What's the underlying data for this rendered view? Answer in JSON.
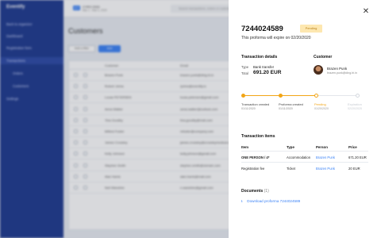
{
  "app": {
    "logo": "Eventify",
    "nav": [
      {
        "label": "Back to organizer",
        "sub": false
      },
      {
        "label": "Dashboard",
        "sub": false
      },
      {
        "label": "Registration form",
        "sub": false
      },
      {
        "label": "Transactions",
        "sub": false
      },
      {
        "label": "Orders",
        "sub": true
      },
      {
        "label": "Customers",
        "sub": true
      },
      {
        "label": "Settings",
        "sub": false
      }
    ],
    "event": {
      "badge": "EVT",
      "name": "CYRO 2020",
      "date": "Mar 1 - Mar 3, 2020"
    },
    "search_placeholder": "Search transactions, orders or customers",
    "page_title": "Customers",
    "filter_label": "Add a filter",
    "add_label": "Add",
    "table": {
      "columns": [
        "Customer",
        "Email"
      ],
      "rows": [
        [
          "Brazen Punk",
          "brazen.punk@ding.bi.in"
        ],
        [
          "Robert Johns",
          "rjohns@eventify.io"
        ],
        [
          "Lucas PETERSEN",
          "lucas.petersen@gmail.com"
        ],
        [
          "Anna Walker",
          "anna.walker@outlook.com"
        ],
        [
          "Tina Goodby",
          "tina.goodby@mail.com"
        ],
        [
          "Miltred Foster",
          "mfoster@company.com"
        ],
        [
          "James Crossley",
          "james.crossley@crossleymedical.co.uk"
        ],
        [
          "Kelly Johnson",
          "kelly.johnson@gmail.com"
        ],
        [
          "Stephen Smith",
          "stephen.smith@domain.com"
        ],
        [
          "Alan Harris",
          "alan.harris@mail.com"
        ],
        [
          "Neil Wanshire",
          "n.wanshire@gmail.com"
        ]
      ]
    }
  },
  "panel": {
    "close_icon": "close-icon",
    "proforma_number": "7244024589",
    "status": "Pending",
    "expire_text": "This proforma will expire on 02/20/2020",
    "details": {
      "heading": "Transaction details",
      "type_label": "Type",
      "type_value": "Bank transfer",
      "total_label": "Total",
      "total_value": "691.20 EUR"
    },
    "customer": {
      "heading": "Customer",
      "name": "Brazen Punk",
      "email": "brazen.punk@ding.bi.in"
    },
    "timeline": [
      {
        "label": "Transaction created",
        "date": "01/11/2020",
        "state": "done"
      },
      {
        "label": "Proforma created",
        "date": "01/11/2020",
        "state": "done"
      },
      {
        "label": "Pending",
        "date": "01/20/2020",
        "state": "current"
      },
      {
        "label": "Expiration",
        "date": "02/20/2020",
        "state": "future"
      }
    ],
    "items": {
      "heading": "Transaction items",
      "columns": [
        "Item",
        "Type",
        "Person",
        "Price"
      ],
      "rows": [
        {
          "item": "ONE PERSON / 4*",
          "type": "Accommodation",
          "person": "Brazen Punk",
          "price": "671.20 EUR"
        },
        {
          "item": "Registration fee",
          "type": "Ticket",
          "person": "Brazen Punk",
          "price": "20 EUR"
        }
      ]
    },
    "documents": {
      "heading": "Documents",
      "count": "(1)",
      "download_label": "Download proforma 7244024589",
      "icon": "download-icon"
    }
  },
  "colors": {
    "sidebar": "#1e3a8f",
    "accent": "#3b82f6",
    "pending": "#f2a516",
    "pending_bg": "#fde7b0"
  }
}
